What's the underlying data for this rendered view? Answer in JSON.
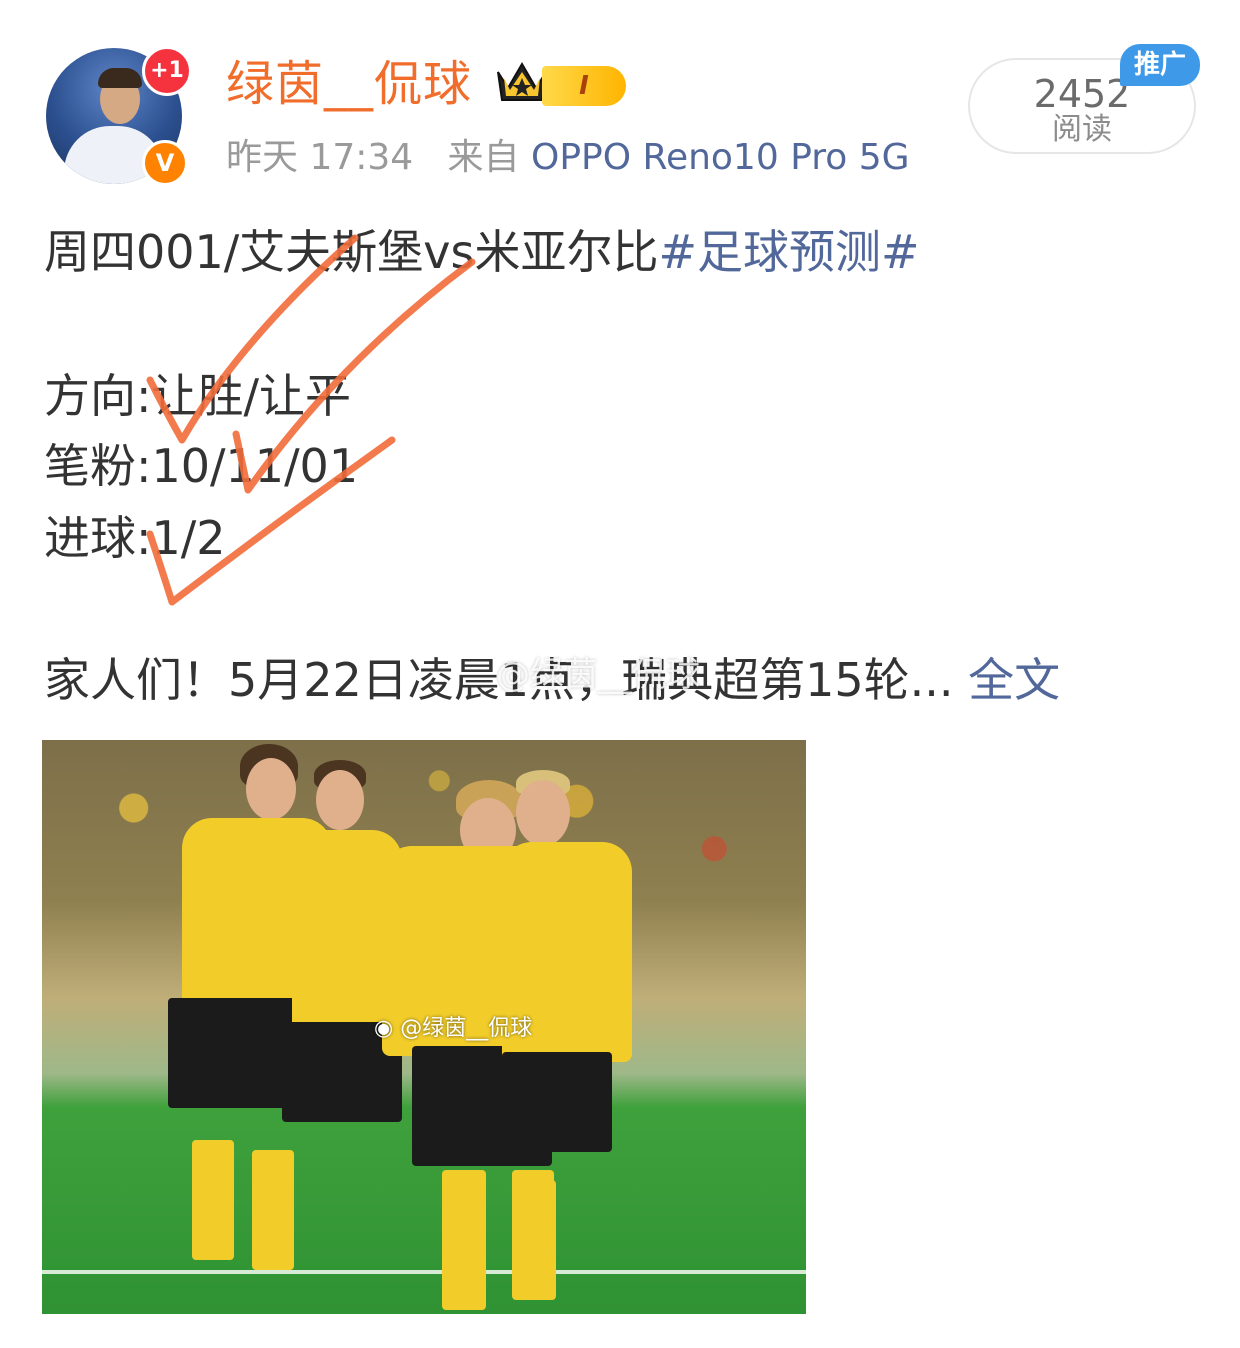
{
  "post": {
    "author": {
      "name": "绿茵__侃球",
      "level_badge": "I",
      "notification_badge": "+1",
      "verified_mark": "V"
    },
    "time": "昨天 17:34",
    "source_prefix": "来自",
    "source_device": "OPPO Reno10 Pro 5G",
    "read_count": "2452",
    "read_label": "阅读",
    "promo_badge": "推广",
    "lines": {
      "headline": "周四001/艾夫斯堡vs米亚尔比",
      "hashtag": "#足球预测#",
      "direction": "方向:让胜/让平",
      "scores": "笔粉:10/11/01",
      "goals": "进球:1/2",
      "teaser": "家人们！5月22日凌晨1点，瑞典超第15轮...",
      "fulltext_link": "全文"
    },
    "watermark": "@绿茵__侃球",
    "photo_watermark": "@绿茵__侃球"
  },
  "colors": {
    "username": "#f06d2c",
    "link": "#52689a",
    "check_marks": "#f26b3a",
    "promo": "#3e9ae8",
    "jersey": "#f2cd2a"
  },
  "icons": {
    "crown": "crown-icon",
    "verified": "verified-v-icon",
    "weibo_logo": "weibo-logo-icon"
  }
}
